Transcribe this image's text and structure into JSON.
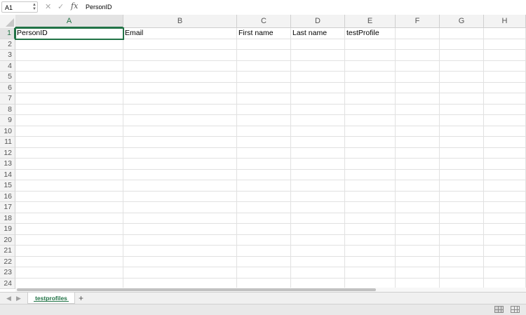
{
  "formula_bar": {
    "name_box": "A1",
    "cancel_glyph": "✕",
    "confirm_glyph": "✓",
    "fx_label": "fx",
    "formula": "PersonID"
  },
  "columns": [
    "A",
    "B",
    "C",
    "D",
    "E",
    "F",
    "G",
    "H"
  ],
  "rows": [
    "1",
    "2",
    "3",
    "4",
    "5",
    "6",
    "7",
    "8",
    "9",
    "10",
    "11",
    "12",
    "13",
    "14",
    "15",
    "16",
    "17",
    "18",
    "19",
    "20",
    "21",
    "22",
    "23",
    "24"
  ],
  "header_cells": [
    "PersonID",
    "Email",
    "First name",
    "Last name",
    "testProfile"
  ],
  "sheet_tabs": {
    "prev_glyph": "◀",
    "next_glyph": "▶",
    "active_tab": "testprofiles",
    "add_glyph": "+"
  },
  "colors": {
    "accent": "#217346"
  }
}
